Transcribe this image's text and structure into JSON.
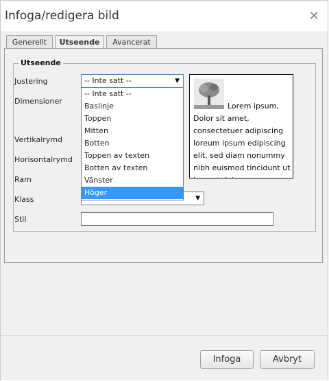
{
  "dialog": {
    "title": "Infoga/redigera bild",
    "close_icon": "close-icon"
  },
  "tabs": [
    {
      "label": "Generellt",
      "active": false
    },
    {
      "label": "Utseende",
      "active": true
    },
    {
      "label": "Avancerat",
      "active": false
    }
  ],
  "appearance": {
    "legend": "Utseende",
    "labels": {
      "alignment": "Justering",
      "dimensions": "Dimensioner",
      "vspace": "Vertikalrymd",
      "hspace": "Horisontalrymd",
      "border": "Ram",
      "class": "Klass",
      "style": "Stil"
    },
    "alignment_value": "-- Inte satt --",
    "alignment_options": [
      "-- Inte satt --",
      "Baslinje",
      "Toppen",
      "Mitten",
      "Botten",
      "Toppen av texten",
      "Botten av texten",
      "Vänster",
      "Höger"
    ],
    "alignment_highlighted": "Höger",
    "class_value": "-- Inte satt --",
    "style_value": "",
    "preview_text": "Lorem ipsum, Dolor sit amet, consectetuer adipiscing loreum ipsum edipiscing elit, sed diam nonummy nibh euismod tincidunt ut laoreet dolore magna aliquam erat volutpat.",
    "preview_image_icon": "tree-image-icon"
  },
  "buttons": {
    "insert": "Infoga",
    "cancel": "Avbryt"
  },
  "colors": {
    "highlight": "#3399ff",
    "dialog_bg": "#f0f0f0"
  }
}
